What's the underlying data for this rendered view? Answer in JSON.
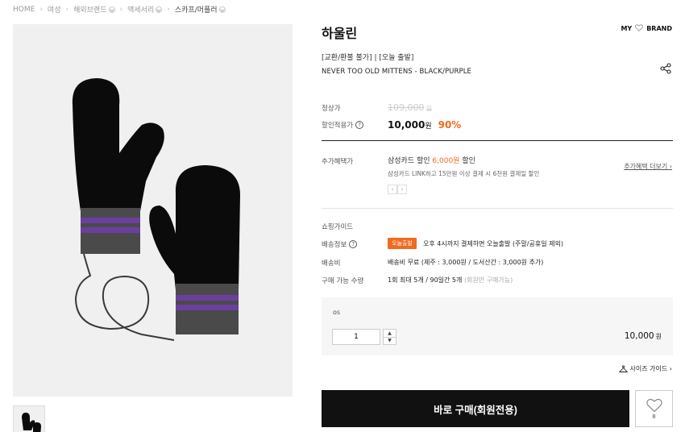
{
  "breadcrumb": [
    {
      "label": "HOME",
      "has_dropdown": false
    },
    {
      "label": "여성",
      "has_dropdown": false
    },
    {
      "label": "해외브랜드",
      "has_dropdown": true
    },
    {
      "label": "액세서리",
      "has_dropdown": true
    },
    {
      "label": "스카프/머플러",
      "has_dropdown": true
    }
  ],
  "product": {
    "brand_title": "하울린",
    "tags": "[교환/환불 불가] | [오늘 출발]",
    "name": "NEVER TOO OLD MITTENS - BLACK/PURPLE"
  },
  "header_actions": {
    "my": "MY",
    "brand": "BRAND"
  },
  "price": {
    "regular_label": "정상가",
    "regular_value": "109,000",
    "regular_unit": "원",
    "sale_label": "할인적용가",
    "sale_value": "10,000",
    "sale_unit": "원",
    "discount_rate": "90%"
  },
  "benefit": {
    "label": "추가혜택가",
    "card_prefix": "삼성카드 할인 ",
    "card_amount": "6,000원",
    "card_suffix": " 할인",
    "card_detail": "삼성카드 LINK하고 15만원 이상 결제 시 6천원 결제일 할인",
    "more_link": "추가혜택 더보기"
  },
  "shopping_guide": {
    "title": "쇼핑가이드",
    "shipping_label": "배송정보",
    "shipping_badge": "오늘출발",
    "shipping_text": "오후 4시까지 결제하면 오늘출발 (주말/공휴일 제외)",
    "fee_label": "배송비",
    "fee_text": "배송비 무료 (제주 : 3,000원 / 도서산간 : 3,000원 추가)",
    "limit_label": "구매 가능 수량",
    "limit_text": "1회 최대 5개 / 90일간 5개",
    "limit_note": "(회원만 구매가능)"
  },
  "option": {
    "name": "os",
    "quantity": "1",
    "price": "10,000",
    "unit": "원"
  },
  "size_guide": "사이즈 가이드",
  "buy_button": "바로 구매(회원전용)",
  "like_count": "8",
  "colors": {
    "accent": "#f16a1f",
    "button": "#111111"
  }
}
